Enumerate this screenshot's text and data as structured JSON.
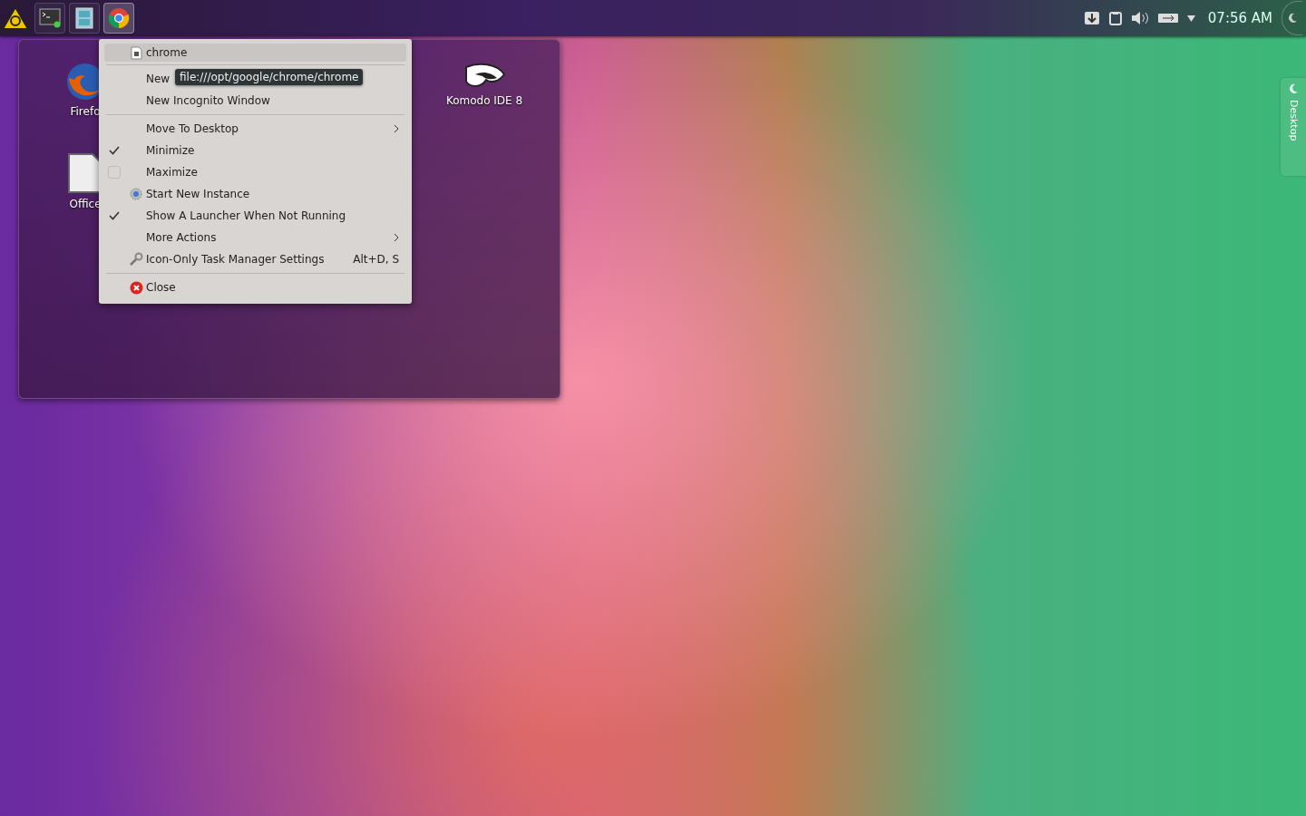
{
  "panel": {
    "tasks": [
      {
        "kind": "terminal",
        "selected": false
      },
      {
        "kind": "files",
        "selected": false
      },
      {
        "kind": "browser",
        "selected": true
      }
    ],
    "clock": "07:56 AM"
  },
  "folder_view": {
    "icons": [
      {
        "kind": "firefox",
        "label": "Firefo"
      },
      {
        "kind": "komodo",
        "label": "Komodo IDE 8"
      },
      {
        "kind": "office",
        "label": "Office"
      }
    ]
  },
  "context_menu": {
    "items": [
      {
        "kind": "title",
        "label": "chrome"
      },
      {
        "kind": "separator"
      },
      {
        "kind": "action",
        "label": "New"
      },
      {
        "kind": "action",
        "label": "New Incognito Window"
      },
      {
        "kind": "separator"
      },
      {
        "kind": "submenu",
        "label": "Move To Desktop"
      },
      {
        "kind": "checkbox",
        "label": "Minimize",
        "checked": true
      },
      {
        "kind": "checkbox",
        "label": "Maximize",
        "checked": false
      },
      {
        "kind": "launch",
        "label": "Start New Instance"
      },
      {
        "kind": "checkbox",
        "label": "Show A Launcher When Not Running",
        "checked": true
      },
      {
        "kind": "submenu",
        "label": "More Actions"
      },
      {
        "kind": "settings",
        "label": "Icon-Only Task Manager Settings",
        "shortcut": "Alt+D, S"
      },
      {
        "kind": "separator"
      },
      {
        "kind": "close",
        "label": "Close"
      }
    ]
  },
  "tooltip": "file:///opt/google/chrome/chrome",
  "side_tab": "Desktop"
}
